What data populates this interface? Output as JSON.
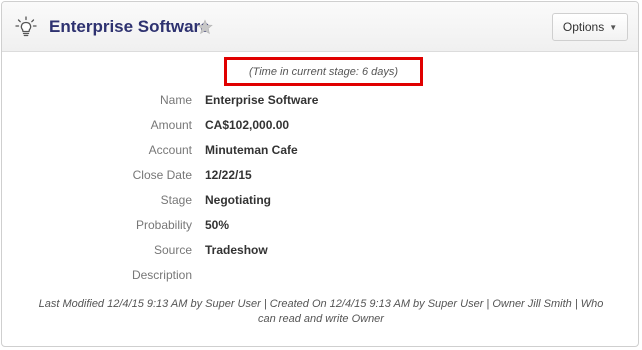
{
  "header": {
    "title": "Enterprise Software",
    "icon": "lightbulb-icon",
    "favorite_icon": "star-icon",
    "options_label": "Options"
  },
  "time_in_stage": "(Time in current stage: 6 days)",
  "fields": [
    {
      "label": "Name",
      "value": "Enterprise Software"
    },
    {
      "label": "Amount",
      "value": "CA$102,000.00"
    },
    {
      "label": "Account",
      "value": "Minuteman Cafe"
    },
    {
      "label": "Close Date",
      "value": "12/22/15"
    },
    {
      "label": "Stage",
      "value": "Negotiating"
    },
    {
      "label": "Probability",
      "value": "50%"
    },
    {
      "label": "Source",
      "value": "Tradeshow"
    },
    {
      "label": "Description",
      "value": ""
    }
  ],
  "footer": "Last Modified 12/4/15 9:13 AM by Super User | Created On 12/4/15 9:13 AM by Super User | Owner Jill Smith | Who can read and write Owner",
  "colors": {
    "title": "#2e3270",
    "highlight_border": "#e00000"
  }
}
